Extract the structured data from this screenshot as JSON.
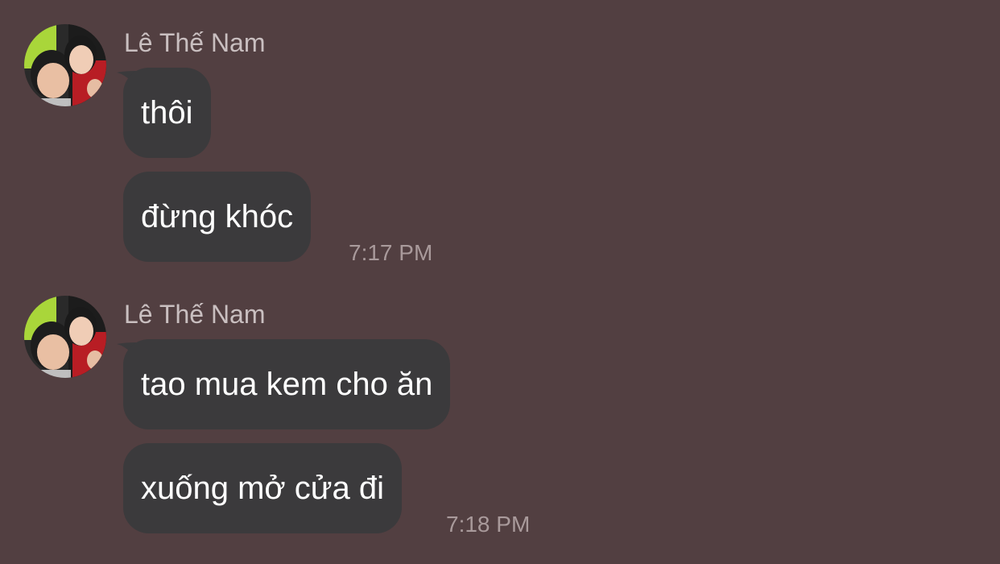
{
  "colors": {
    "background": "#523f41",
    "bubble": "#3b3a3c",
    "message_text": "#ffffff",
    "sender_text": "#c9bfc0",
    "timestamp_text": "#a99a9b"
  },
  "groups": [
    {
      "sender": "Lê Thế Nam",
      "avatar_icon": "user-avatar-photo",
      "messages": [
        "thôi",
        "đừng khóc"
      ],
      "time": "7:17 PM"
    },
    {
      "sender": "Lê Thế Nam",
      "avatar_icon": "user-avatar-photo",
      "messages": [
        "tao mua kem cho ăn",
        "xuống mở cửa đi"
      ],
      "time": "7:18 PM"
    }
  ]
}
